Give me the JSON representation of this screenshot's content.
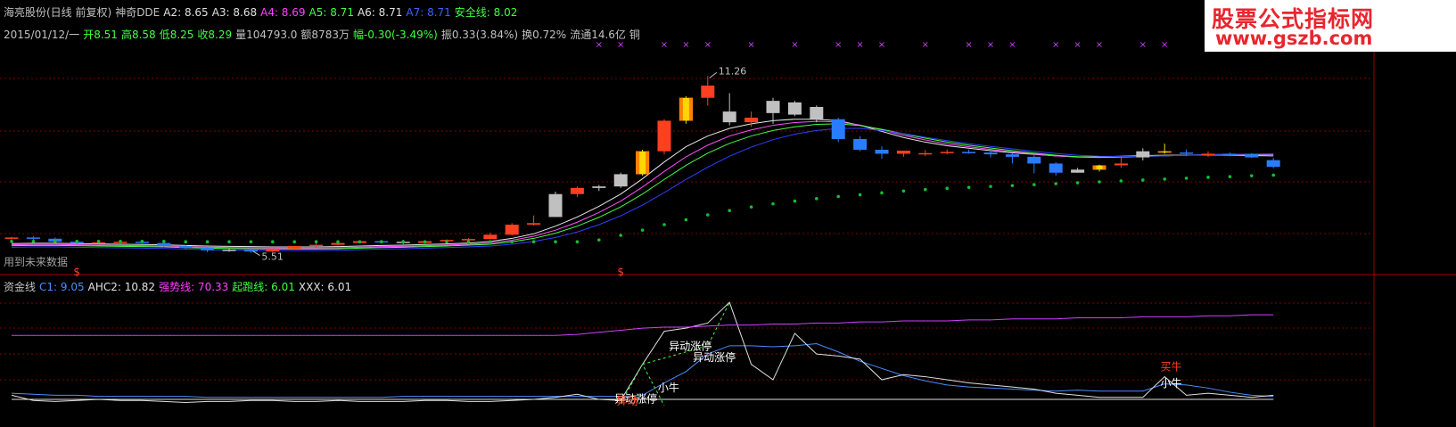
{
  "header": {
    "items": [
      {
        "text": "海亮股份(日线 前复权)",
        "color": "#c0c0c0"
      },
      {
        "text": "神奇DDE",
        "color": "#c0c0c0"
      },
      {
        "text": "A2: 8.65",
        "color": "#e0e0e0"
      },
      {
        "text": "A3: 8.68",
        "color": "#e0e0e0"
      },
      {
        "text": "A4: 8.69",
        "color": "#ff40ff"
      },
      {
        "text": "A5: 8.71",
        "color": "#40ff40"
      },
      {
        "text": "A6: 8.71",
        "color": "#e0e0e0"
      },
      {
        "text": "A7: 8.71",
        "color": "#4060ff"
      },
      {
        "text": "安全线: 8.02",
        "color": "#40ff40"
      }
    ]
  },
  "info_bar": {
    "items": [
      {
        "text": "2015/01/12/一",
        "color": "#c0c0c0"
      },
      {
        "text": "开8.51",
        "color": "#40ff40"
      },
      {
        "text": "高8.58",
        "color": "#40ff40"
      },
      {
        "text": "低8.25",
        "color": "#40ff40"
      },
      {
        "text": "收8.29",
        "color": "#40ff40"
      },
      {
        "text": "量104793.0",
        "color": "#c0c0c0"
      },
      {
        "text": "额8783万",
        "color": "#c0c0c0"
      },
      {
        "text": "幅-0.30(-3.49%)",
        "color": "#40ff40"
      },
      {
        "text": "振0.33(3.84%)",
        "color": "#c0c0c0"
      },
      {
        "text": "换0.72%",
        "color": "#c0c0c0"
      },
      {
        "text": "流通14.6亿",
        "color": "#c0c0c0"
      },
      {
        "text": "铜",
        "color": "#c0c0c0"
      }
    ]
  },
  "sub_header": {
    "items": [
      {
        "text": "资金线",
        "color": "#c0c0c0"
      },
      {
        "text": "C1: 9.05",
        "color": "#4c8cff"
      },
      {
        "text": "AHC2: 10.82",
        "color": "#e0e0e0"
      },
      {
        "text": "强势线: 70.33",
        "color": "#ff40ff"
      },
      {
        "text": "起跑线: 6.01",
        "color": "#40ff40"
      },
      {
        "text": "XXX: 6.01",
        "color": "#e0e0e0"
      }
    ]
  },
  "watermark": {
    "line1": "股票公式指标网",
    "line2": "www.gszb.com"
  },
  "colors": {
    "up": "#ff4020",
    "down": "#2a7cff",
    "gold": "#ffd800",
    "flat": "#c0c0c0",
    "magenta": "#d040ff",
    "safe": "#10c030",
    "grid": "#800000"
  },
  "chart_data": [
    {
      "type": "candlestick",
      "panel": "main",
      "ylim": [
        5.0,
        12.0
      ],
      "open": [
        5.95,
        5.98,
        5.94,
        5.84,
        5.8,
        5.82,
        5.84,
        5.8,
        5.7,
        5.64,
        5.56,
        5.58,
        5.52,
        5.61,
        5.7,
        5.74,
        5.8,
        5.86,
        5.84,
        5.8,
        5.86,
        5.9,
        5.93,
        6.07,
        6.4,
        6.65,
        7.4,
        7.6,
        7.65,
        8.05,
        8.8,
        9.8,
        10.55,
        10.1,
        9.75,
        10.05,
        10.4,
        10.25,
        9.85,
        9.2,
        8.85,
        8.72,
        8.72,
        8.74,
        8.78,
        8.76,
        8.7,
        8.62,
        8.4,
        8.1,
        8.2,
        8.34,
        8.6,
        8.8,
        8.76,
        8.72,
        8.72,
        8.69,
        8.51
      ],
      "high": [
        6.0,
        6.02,
        5.98,
        5.9,
        5.86,
        5.86,
        5.87,
        5.84,
        5.74,
        5.68,
        5.62,
        5.62,
        5.58,
        5.71,
        5.78,
        5.82,
        5.88,
        5.9,
        5.9,
        5.88,
        5.92,
        5.96,
        6.14,
        6.45,
        6.7,
        7.48,
        7.65,
        7.7,
        8.1,
        8.85,
        9.85,
        10.6,
        11.26,
        10.7,
        10.1,
        10.55,
        10.45,
        10.3,
        9.9,
        9.3,
        8.96,
        8.8,
        8.84,
        8.86,
        8.86,
        8.82,
        8.74,
        8.68,
        8.44,
        8.26,
        8.36,
        8.64,
        8.9,
        9.05,
        8.86,
        8.8,
        8.76,
        8.74,
        8.58
      ],
      "low": [
        5.9,
        5.88,
        5.8,
        5.76,
        5.78,
        5.78,
        5.78,
        5.66,
        5.6,
        5.5,
        5.51,
        5.48,
        5.5,
        5.58,
        5.66,
        5.72,
        5.78,
        5.8,
        5.76,
        5.78,
        5.84,
        5.88,
        5.92,
        6.05,
        6.37,
        7.35,
        7.3,
        7.5,
        7.6,
        8.0,
        8.7,
        9.7,
        10.3,
        9.65,
        9.6,
        9.7,
        9.95,
        9.75,
        9.1,
        8.8,
        8.55,
        8.62,
        8.64,
        8.7,
        8.72,
        8.6,
        8.4,
        8.08,
        8.0,
        8.1,
        8.14,
        8.26,
        8.5,
        8.72,
        8.64,
        8.62,
        8.64,
        8.58,
        8.25
      ],
      "close": [
        5.98,
        5.94,
        5.84,
        5.8,
        5.82,
        5.84,
        5.8,
        5.7,
        5.64,
        5.56,
        5.58,
        5.52,
        5.61,
        5.7,
        5.74,
        5.8,
        5.86,
        5.84,
        5.8,
        5.86,
        5.9,
        5.93,
        6.07,
        6.4,
        6.45,
        7.4,
        7.6,
        7.65,
        8.05,
        8.8,
        9.8,
        10.55,
        10.95,
        9.75,
        9.9,
        10.45,
        10.0,
        9.85,
        9.2,
        8.85,
        8.72,
        8.82,
        8.74,
        8.78,
        8.76,
        8.7,
        8.62,
        8.4,
        8.1,
        8.2,
        8.34,
        8.4,
        8.8,
        8.76,
        8.72,
        8.72,
        8.69,
        8.6,
        8.29
      ],
      "gold_bars": [
        29,
        31,
        50,
        53
      ],
      "flat_bars": [
        10,
        18,
        25,
        27,
        28,
        33,
        35,
        36,
        37,
        49,
        52
      ],
      "ma_lines": {
        "A2": [
          5.78,
          5.79,
          5.79,
          5.78,
          5.77,
          5.76,
          5.75,
          5.74,
          5.72,
          5.7,
          5.69,
          5.68,
          5.67,
          5.67,
          5.67,
          5.68,
          5.7,
          5.72,
          5.73,
          5.75,
          5.77,
          5.8,
          5.85,
          5.95,
          6.1,
          6.35,
          6.65,
          7.0,
          7.4,
          7.9,
          8.45,
          8.95,
          9.3,
          9.55,
          9.7,
          9.8,
          9.85,
          9.85,
          9.8,
          9.65,
          9.45,
          9.25,
          9.1,
          8.98,
          8.9,
          8.82,
          8.75,
          8.7,
          8.65,
          8.62,
          8.62,
          8.64,
          8.66,
          8.67,
          8.68,
          8.68,
          8.67,
          8.66,
          8.65
        ],
        "A4": [
          5.74,
          5.75,
          5.75,
          5.74,
          5.73,
          5.72,
          5.71,
          5.7,
          5.68,
          5.66,
          5.65,
          5.64,
          5.63,
          5.63,
          5.63,
          5.64,
          5.66,
          5.68,
          5.69,
          5.71,
          5.73,
          5.76,
          5.8,
          5.89,
          6.02,
          6.22,
          6.48,
          6.8,
          7.17,
          7.63,
          8.14,
          8.62,
          9.0,
          9.3,
          9.5,
          9.65,
          9.74,
          9.78,
          9.76,
          9.66,
          9.5,
          9.32,
          9.17,
          9.04,
          8.95,
          8.86,
          8.78,
          8.71,
          8.65,
          8.61,
          8.6,
          8.62,
          8.64,
          8.66,
          8.67,
          8.68,
          8.68,
          8.69,
          8.69
        ],
        "A5": [
          5.71,
          5.72,
          5.72,
          5.71,
          5.7,
          5.69,
          5.68,
          5.67,
          5.65,
          5.63,
          5.62,
          5.61,
          5.6,
          5.6,
          5.6,
          5.61,
          5.63,
          5.65,
          5.66,
          5.68,
          5.7,
          5.73,
          5.76,
          5.84,
          5.95,
          6.12,
          6.35,
          6.64,
          6.98,
          7.4,
          7.88,
          8.34,
          8.74,
          9.06,
          9.3,
          9.48,
          9.6,
          9.68,
          9.7,
          9.64,
          9.52,
          9.37,
          9.23,
          9.1,
          9.0,
          8.91,
          8.82,
          8.74,
          8.67,
          8.62,
          8.6,
          8.61,
          8.63,
          8.65,
          8.67,
          8.69,
          8.7,
          8.7,
          8.71
        ],
        "A7": [
          5.66,
          5.67,
          5.67,
          5.66,
          5.65,
          5.64,
          5.63,
          5.62,
          5.6,
          5.58,
          5.57,
          5.56,
          5.55,
          5.55,
          5.55,
          5.56,
          5.58,
          5.6,
          5.61,
          5.63,
          5.65,
          5.67,
          5.7,
          5.76,
          5.85,
          5.98,
          6.16,
          6.4,
          6.69,
          7.04,
          7.45,
          7.88,
          8.28,
          8.64,
          8.94,
          9.18,
          9.36,
          9.48,
          9.55,
          9.55,
          9.48,
          9.38,
          9.26,
          9.15,
          9.05,
          8.96,
          8.88,
          8.8,
          8.73,
          8.67,
          8.64,
          8.63,
          8.64,
          8.65,
          8.67,
          8.69,
          8.7,
          8.71,
          8.71
        ]
      },
      "safe_line": [
        5.85,
        5.85,
        5.85,
        5.85,
        5.85,
        5.85,
        5.85,
        5.85,
        5.84,
        5.84,
        5.84,
        5.84,
        5.84,
        5.84,
        5.84,
        5.84,
        5.84,
        5.84,
        5.84,
        5.84,
        5.84,
        5.84,
        5.84,
        5.84,
        5.84,
        5.84,
        5.84,
        5.9,
        6.05,
        6.22,
        6.4,
        6.56,
        6.72,
        6.86,
        6.98,
        7.08,
        7.17,
        7.25,
        7.32,
        7.38,
        7.44,
        7.5,
        7.55,
        7.59,
        7.62,
        7.65,
        7.68,
        7.71,
        7.74,
        7.77,
        7.8,
        7.83,
        7.86,
        7.89,
        7.92,
        7.95,
        7.97,
        8.0,
        8.02
      ],
      "annotations": [
        {
          "label": "11.26",
          "bar": 32,
          "value": 11.26
        },
        {
          "label": "5.51",
          "bar": 11,
          "value": 5.48
        }
      ],
      "markers": [
        {
          "label": "$",
          "bar": 3
        },
        {
          "label": "$",
          "bar": 28
        }
      ],
      "x_markers_bars": [
        27,
        28,
        30,
        31,
        32,
        34,
        36,
        38,
        39,
        40,
        42,
        44,
        45,
        46,
        48,
        49,
        50,
        52,
        53,
        55,
        56,
        58
      ],
      "footnote": "用到未来数据"
    },
    {
      "type": "line",
      "panel": "sub",
      "ylim": [
        0,
        120
      ],
      "series": [
        {
          "name": "C1",
          "color": "#4c8cff",
          "values": [
            12,
            11,
            10,
            10,
            9,
            9,
            9,
            9,
            9,
            8,
            8,
            8,
            8,
            8,
            8,
            8,
            8,
            8,
            9,
            9,
            9,
            9,
            9,
            9,
            9,
            9,
            9,
            9,
            9,
            10,
            22,
            33,
            50,
            58,
            58,
            57,
            58,
            60,
            52,
            43,
            36,
            29,
            24,
            20,
            18,
            17,
            16,
            15,
            14,
            15,
            14,
            14,
            14,
            21,
            20,
            17,
            13,
            10,
            9
          ]
        },
        {
          "name": "AHC2",
          "color": "#e0e0e0",
          "values": [
            10,
            5,
            4,
            5,
            6,
            5,
            5,
            4,
            3,
            4,
            4,
            5,
            5,
            4,
            4,
            5,
            4,
            4,
            4,
            5,
            5,
            4,
            4,
            5,
            6,
            8,
            11,
            6,
            5,
            40,
            72,
            75,
            80,
            100,
            40,
            25,
            70,
            50,
            48,
            45,
            25,
            30,
            28,
            25,
            22,
            20,
            18,
            16,
            12,
            10,
            8,
            8,
            8,
            28,
            10,
            12,
            10,
            8,
            10
          ]
        },
        {
          "name": "强势线",
          "color": "#d040ff",
          "values": [
            68,
            68,
            68,
            68,
            68,
            68,
            68,
            68,
            68,
            68,
            68,
            68,
            68,
            68,
            68,
            68,
            68,
            68,
            68,
            68,
            68,
            68,
            68,
            68,
            68,
            68,
            69,
            71,
            73,
            75,
            76,
            76,
            77,
            78,
            78,
            79,
            79,
            80,
            80,
            81,
            81,
            82,
            82,
            82,
            83,
            83,
            84,
            84,
            84,
            85,
            85,
            85,
            86,
            86,
            86,
            87,
            87,
            88,
            88
          ]
        },
        {
          "name": "起跑线",
          "color": "#40ff40",
          "values": [
            6,
            6,
            6,
            6,
            6,
            6,
            6,
            6,
            6,
            6,
            6,
            6,
            6,
            6,
            6,
            6,
            6,
            6,
            6,
            6,
            6,
            6,
            6,
            6,
            6,
            6,
            6,
            6,
            6,
            6,
            6,
            6,
            6,
            6,
            6,
            6,
            6,
            6,
            6,
            6,
            6,
            6,
            6,
            6,
            6,
            6,
            6,
            6,
            6,
            6,
            6,
            6,
            6,
            6,
            6,
            6,
            6,
            6,
            6
          ]
        },
        {
          "name": "XXX",
          "color": "#e0e0e0",
          "values": [
            6,
            6,
            6,
            6,
            6,
            6,
            6,
            6,
            6,
            6,
            6,
            6,
            6,
            6,
            6,
            6,
            6,
            6,
            6,
            6,
            6,
            6,
            6,
            6,
            6,
            6,
            6,
            6,
            6,
            6,
            6,
            6,
            6,
            6,
            6,
            6,
            6,
            6,
            6,
            6,
            6,
            6,
            6,
            6,
            6,
            6,
            6,
            6,
            6,
            6,
            6,
            6,
            6,
            6,
            6,
            6,
            6,
            6,
            6
          ]
        }
      ],
      "labels": [
        {
          "text": "异动涨停",
          "bar": 31.2,
          "value": 54,
          "color": "#ffffff"
        },
        {
          "text": "异动涨停",
          "bar": 32.3,
          "value": 43,
          "color": "#ffffff"
        },
        {
          "text": "小牛",
          "bar": 30.2,
          "value": 14,
          "color": "#ffffff"
        },
        {
          "text": "异动涨停",
          "bar": 28.7,
          "value": 3,
          "color": "#ffffff"
        },
        {
          "text": "异动",
          "bar": 28.3,
          "value": 1,
          "color": "#ff4020"
        },
        {
          "text": "小牛",
          "bar": 53.3,
          "value": 18,
          "color": "#ffffff"
        },
        {
          "text": "买牛",
          "bar": 53.3,
          "value": 34,
          "color": "#ff4020"
        }
      ]
    }
  ]
}
